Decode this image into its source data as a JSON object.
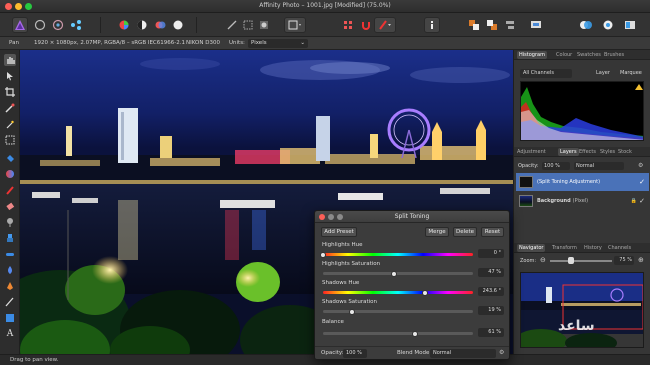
{
  "window": {
    "title": "Affinity Photo – 1001.jpg [Modified] (75.0%)"
  },
  "context_bar": {
    "tool": "Pan",
    "image_info": "1920 × 1080px, 2.07MP, RGBA/8 – sRGB IEC61966-2.1",
    "camera": "NIKON D300",
    "units_label": "Units:",
    "units_value": "Pixels"
  },
  "panels": {
    "top_tabs": [
      "Histogram",
      "Colour",
      "Swatches",
      "Brushes"
    ],
    "channels": "All Channels",
    "layer_btn": "Layer",
    "marquee_btn": "Marquee",
    "mid_tabs": [
      "Adjustment",
      "Layers",
      "Effects",
      "Styles",
      "Stock"
    ],
    "opacity_label": "Opacity:",
    "opacity_value": "100 %",
    "blend_value": "Normal",
    "layers": [
      {
        "name": "(Split Toning Adjustment)"
      },
      {
        "name": "Background",
        "suffix": "(Pixel)"
      }
    ],
    "nav_tabs": [
      "Navigator",
      "Transform",
      "History",
      "Channels"
    ],
    "zoom_label": "Zoom:",
    "zoom_value": "75 %"
  },
  "dialog": {
    "title": "Split Toning",
    "add_preset": "Add Preset",
    "merge": "Merge",
    "delete": "Delete",
    "reset": "Reset",
    "sliders": [
      {
        "label": "Highlights Hue",
        "value": "0 °",
        "level": 0.0
      },
      {
        "label": "Highlights Saturation",
        "value": "47 %",
        "level": 0.47
      },
      {
        "label": "Shadows Hue",
        "value": "243.6 °",
        "level": 0.68
      },
      {
        "label": "Shadows Saturation",
        "value": "19 %",
        "level": 0.19
      },
      {
        "label": "Balance",
        "value": "61 %",
        "level": 0.61
      }
    ],
    "opacity_label": "Opacity:",
    "opacity_value": "100 %",
    "blend_label": "Blend Mode:",
    "blend_value": "Normal"
  },
  "status": {
    "text": "Drag to pan view."
  },
  "watermark": "ساعد"
}
